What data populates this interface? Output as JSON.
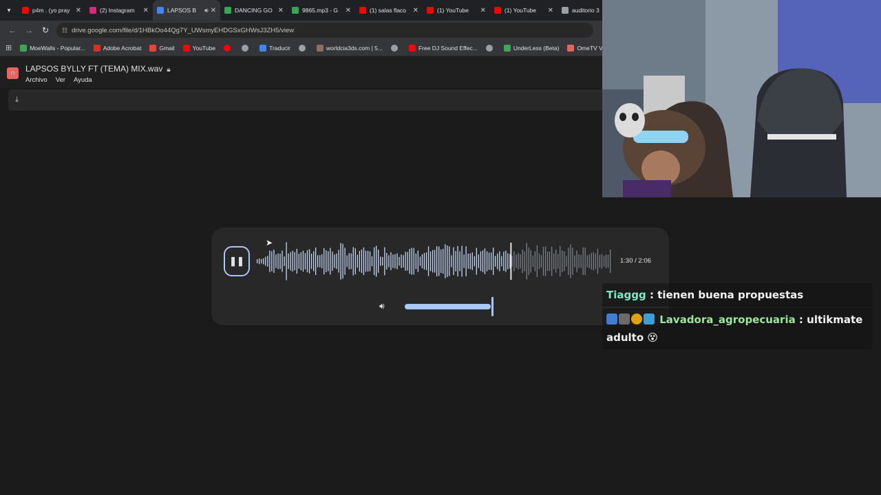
{
  "tabs": [
    {
      "title": "p4m . (yo pray",
      "favicon_color": "#ff0000",
      "active": false
    },
    {
      "title": "(2) Instagram",
      "favicon_color": "#d62976",
      "active": false
    },
    {
      "title": "LAPSOS B",
      "favicon_color": "#4285f4",
      "active": true
    },
    {
      "title": "DANCING GO",
      "favicon_color": "#34a853",
      "active": false
    },
    {
      "title": "9865.mp3 - G",
      "favicon_color": "#34a853",
      "active": false
    },
    {
      "title": "(1) salas flaco",
      "favicon_color": "#ff0000",
      "active": false
    },
    {
      "title": "(1) YouTube",
      "favicon_color": "#ff0000",
      "active": false
    },
    {
      "title": "(1) YouTube",
      "favicon_color": "#ff0000",
      "active": false
    },
    {
      "title": "auditorio 3",
      "favicon_color": "#9aa0a6",
      "active": false
    }
  ],
  "address": {
    "url": "drive.google.com/file/d/1HBkOo44Qg7Y_UWsmyEHDGSxGHWsJ3ZH5/view"
  },
  "bookmarks": [
    {
      "label": "MoeWalls - Popular...",
      "color": "#3aa757"
    },
    {
      "label": "Adobe Acrobat",
      "color": "#d93025"
    },
    {
      "label": "Gmail",
      "color": "#ea4335"
    },
    {
      "label": "YouTube",
      "color": "#ff0000"
    },
    {
      "label": "",
      "color": "#ff0000"
    },
    {
      "label": "",
      "color": "#9aa0a6"
    },
    {
      "label": "Traducir",
      "color": "#4285f4"
    },
    {
      "label": "",
      "color": "#9aa0a6"
    },
    {
      "label": "worldcia3ds.com | 5...",
      "color": "#8d6e63"
    },
    {
      "label": "",
      "color": "#9aa0a6"
    },
    {
      "label": "Free DJ Sound Effec...",
      "color": "#ff0000"
    },
    {
      "label": "",
      "color": "#9aa0a6"
    },
    {
      "label": "UnderLess (Beta)",
      "color": "#3aa757"
    },
    {
      "label": "OmeTV Video Chat...",
      "color": "#e8655f"
    }
  ],
  "file": {
    "title": "LAPSOS BYLLY FT (TEMA) MIX.wav"
  },
  "menu": {
    "archivo": "Archivo",
    "ver": "Ver",
    "ayuda": "Ayuda"
  },
  "player": {
    "time": "1:30 / 2:06",
    "progress_fraction": 0.714,
    "volume_fraction": 1.0
  },
  "chat": [
    {
      "user": "Tiaggg",
      "separator": " : ",
      "text": "tienen buena propuestas"
    },
    {
      "user": "Lavadora_agropecuaria",
      "separator": " : ",
      "text": "ultikmate adulto 😵"
    }
  ],
  "icons": {
    "tab_menu": "chevron-down-icon",
    "back": "arrow-left-icon",
    "forward": "arrow-right-icon",
    "reload": "reload-icon",
    "site_info": "tune-icon",
    "apps": "apps-grid-icon",
    "download": "download-icon",
    "pause": "pause-icon",
    "volume": "volume-icon",
    "lock": "lock-icon"
  }
}
